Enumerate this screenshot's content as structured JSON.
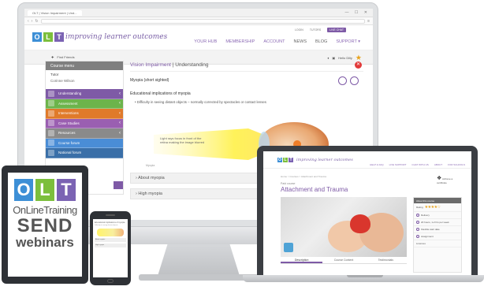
{
  "monitor": {
    "browser": {
      "tab_title": "OLT | Vision Impairment | Und...",
      "window_controls": "— ☐ ✕"
    },
    "site": {
      "logo_letters": [
        "O",
        "L",
        "T"
      ],
      "tagline": "improving learner outcomes",
      "top_links": [
        "LOGIN",
        "TUTORS"
      ],
      "live_chat": "LIVE CHAT",
      "nav": [
        "YOUR HUB",
        "MEMBERSHIP",
        "ACCOUNT",
        "NEWS",
        "BLOG",
        "SUPPORT ▾"
      ],
      "find_friends": "Find Friends",
      "user_name": "Hello Dilly"
    },
    "sidebar": {
      "title": "Course menu",
      "tutor_label": "Tutor",
      "tutor_name": "Corinne Wilson",
      "items": [
        {
          "label": "Understanding"
        },
        {
          "label": "Assessment"
        },
        {
          "label": "Interventions"
        },
        {
          "label": "Case Studies"
        },
        {
          "label": "Resources"
        },
        {
          "label": "Course forum"
        },
        {
          "label": "National forum"
        }
      ]
    },
    "content": {
      "title_prefix": "Vision Impairment",
      "title_suffix": " | Understanding",
      "subtitle": "Myopia (short sighted)",
      "section_title": "Educational implications of myopia",
      "bullet": "Difficulty in seeing distant objects – normally corrected by spectacles or contact lenses",
      "eye_label": "Light rays focus in front of the retina making the image blurred",
      "eye_caption": "Myopia",
      "accordions": [
        "About myopia",
        "High myopia"
      ]
    }
  },
  "laptop": {
    "tagline": "improving learner outcomes",
    "nav": [
      "HELP & FAQ",
      "LIVE SUPPORT",
      "CHAT WITH US",
      "ABOUT",
      "FOR SCHOOLS"
    ],
    "breadcrumb": "Home  >  Courses  >  Attachment and Trauma",
    "course_label": "Paid course",
    "course_title": "Attachment and Trauma",
    "certificate": "Achieve a certificate",
    "sidebox": {
      "heading": "About this course",
      "rating_label": "Rating",
      "rating_stars": "★★★★☆",
      "rows": [
        "Delivery",
        "20 hours, 1-2 hrs per week",
        "Flexible start date",
        "Assignment"
      ],
      "licences_label": "Licences"
    },
    "tabs": [
      "Description",
      "Course Content",
      "Testimonials"
    ]
  },
  "tablet": {
    "logo_letters": [
      "O",
      "L",
      "T"
    ],
    "line1": "OnLineTraining",
    "line2": "SEND",
    "line3": "webinars"
  },
  "phone": {
    "title": "Educational implications of myopia",
    "text": "Difficulty in seeing distant objects",
    "accordions": [
      "About myopia",
      "High myopia"
    ]
  }
}
